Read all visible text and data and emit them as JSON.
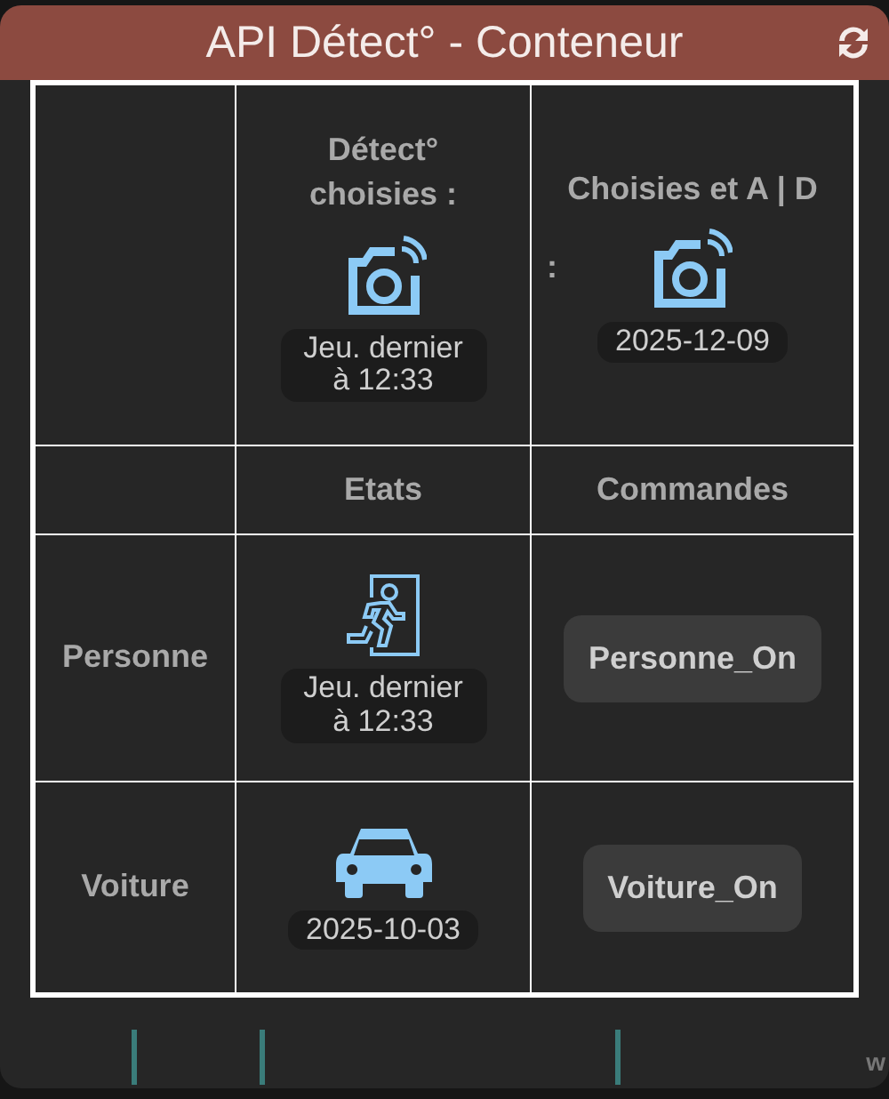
{
  "panel": {
    "title": "API Détect° - Conteneur"
  },
  "table": {
    "top_row": [
      {
        "heading": "Détect° choisies :",
        "badge": "Jeu. dernier à 12:33"
      },
      {
        "heading": "Choisies et A | D",
        "separator": ":",
        "badge": "2025-12-09"
      }
    ],
    "columns": [
      "Etats",
      "Commandes"
    ],
    "rows": [
      {
        "label": "Personne",
        "kind": "person",
        "state": "Jeu. dernier à 12:33",
        "command": "Personne_On"
      },
      {
        "label": "Voiture",
        "kind": "car",
        "state": "2025-10-03",
        "command": "Voiture_On"
      }
    ]
  },
  "footer": {
    "text": "w"
  }
}
